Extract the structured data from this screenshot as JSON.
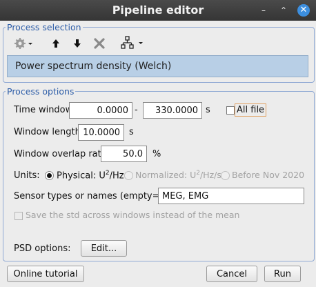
{
  "window": {
    "title": "Pipeline editor",
    "minimize_glyph": "–",
    "restore_glyph": "⌃",
    "close_glyph": "✕"
  },
  "process_selection": {
    "legend": "Process selection",
    "toolbar": [
      "gear-menu-icon",
      "move-up-icon",
      "move-down-icon",
      "delete-icon",
      "pipeline-tree-icon"
    ],
    "selected_process": "Power spectrum density (Welch)",
    "selection_color": "#b8cfe6"
  },
  "process_options": {
    "legend": "Process options",
    "time_window": {
      "label": "Time window:",
      "start": "0.0000",
      "separator": "-",
      "end": "330.0000",
      "unit": "s",
      "all_file_label": "All file",
      "all_file_checked": false
    },
    "window_length": {
      "label": "Window length:",
      "value": "10.0000",
      "unit": "s"
    },
    "window_overlap": {
      "label": "Window overlap ratio:",
      "value": "50.0",
      "unit": "%"
    },
    "units": {
      "label": "Units:",
      "physical": {
        "text": "Physical: U",
        "sup": "2",
        "suffix": "/Hz",
        "selected": true
      },
      "normalized": {
        "text": "Normalized: U",
        "sup": "2",
        "suffix": "/Hz/s",
        "selected": false
      },
      "before_nov": {
        "text": "Before Nov 2020",
        "selected": false
      }
    },
    "sensor_types": {
      "label": "Sensor types or names (empty=all):",
      "value": "MEG, EMG"
    },
    "save_std": {
      "label": "Save the std across windows instead of the mean",
      "checked": false
    },
    "psd_options": {
      "label": "PSD options:",
      "button": "Edit..."
    }
  },
  "footer": {
    "tutorial_button": "Online tutorial",
    "cancel_button": "Cancel",
    "run_button": "Run"
  },
  "colors": {
    "legend": "#2d5da8",
    "titlebar": "#3c3c3c",
    "close_button": "#3c8fe0"
  }
}
